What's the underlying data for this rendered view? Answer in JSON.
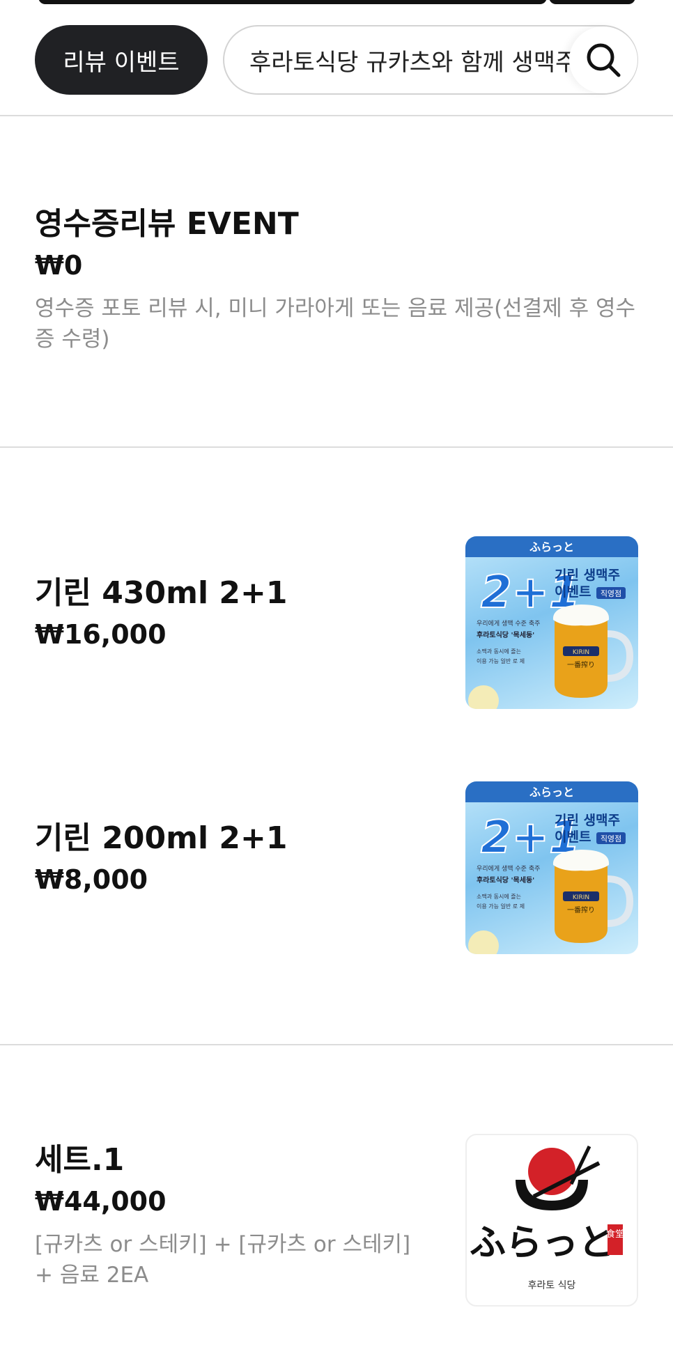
{
  "chips": {
    "active_label": "리뷰 이벤트",
    "inactive_label": "후라토식당 규카츠와 함께 생맥주"
  },
  "sections": [
    {
      "items": [
        {
          "name": "영수증리뷰 EVENT",
          "price": "₩0",
          "description": "영수증 포토 리뷰 시, 미니 가라아게 또는 음료 제공(선결제 후 영수증 수령)"
        }
      ]
    },
    {
      "items": [
        {
          "name": "기린 430ml 2+1",
          "price": "₩16,000"
        },
        {
          "name": "기린 200ml 2+1",
          "price": "₩8,000"
        }
      ]
    },
    {
      "items": [
        {
          "name": "세트.1",
          "price": "₩44,000",
          "description": "[규카츠 or 스테키] + [규카츠 or 스테키] + 음료 2EA"
        }
      ]
    }
  ],
  "beer_image": {
    "headline": "2+1",
    "title_line1": "기린 생맥주",
    "title_line2": "이벤트",
    "tag": "직영점",
    "logo_text": "ふらっと",
    "logo_small": "후라토 식당",
    "copy1": "우리에게 생맥 수준 축주",
    "copy2": "후라토식당 '목세동'",
    "copy3": "소맥과 동시에 즐는",
    "copy4": "이용 가능 일반 로 제",
    "glass_label": "KIRIN",
    "glass_label2": "一番搾り"
  },
  "logo_image": {
    "script": "ふらっと",
    "stamp": "食堂",
    "caption": "후라토 식당"
  },
  "colors": {
    "chip_active_bg": "#202124",
    "desc_gray": "#8c8c8c",
    "divider": "#dcdcdc",
    "logo_red": "#d32128"
  }
}
